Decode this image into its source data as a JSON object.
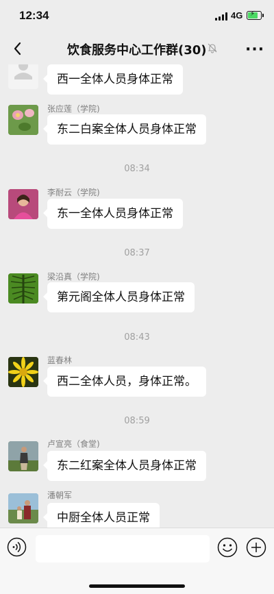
{
  "status": {
    "time": "12:34",
    "network": "4G"
  },
  "header": {
    "title": "饮食服务中心工作群(30)"
  },
  "messages": [
    {
      "sender": "",
      "text": "西一全体人员身体正常"
    },
    {
      "sender": "张应莲（学院)",
      "text": "东二白案全体人员身体正常"
    },
    {
      "sender": "李耐云（学院)",
      "text": "东一全体人员身体正常"
    },
    {
      "sender": "梁沿真（学院)",
      "text": "第元阁全体人员身体正常"
    },
    {
      "sender": "蓝春林",
      "text": "西二全体人员，身体正常。"
    },
    {
      "sender": "卢宣亮（食堂)",
      "text": "东二红案全体人员身体正常"
    },
    {
      "sender": "潘朝军",
      "text": "中厨全体人员正常"
    }
  ],
  "timestamps": [
    "08:34",
    "08:37",
    "08:43",
    "08:59"
  ],
  "icons": [
    "chevron-left-icon",
    "bell-off-icon",
    "more-icon",
    "voice-icon",
    "emoji-icon",
    "plus-icon"
  ]
}
